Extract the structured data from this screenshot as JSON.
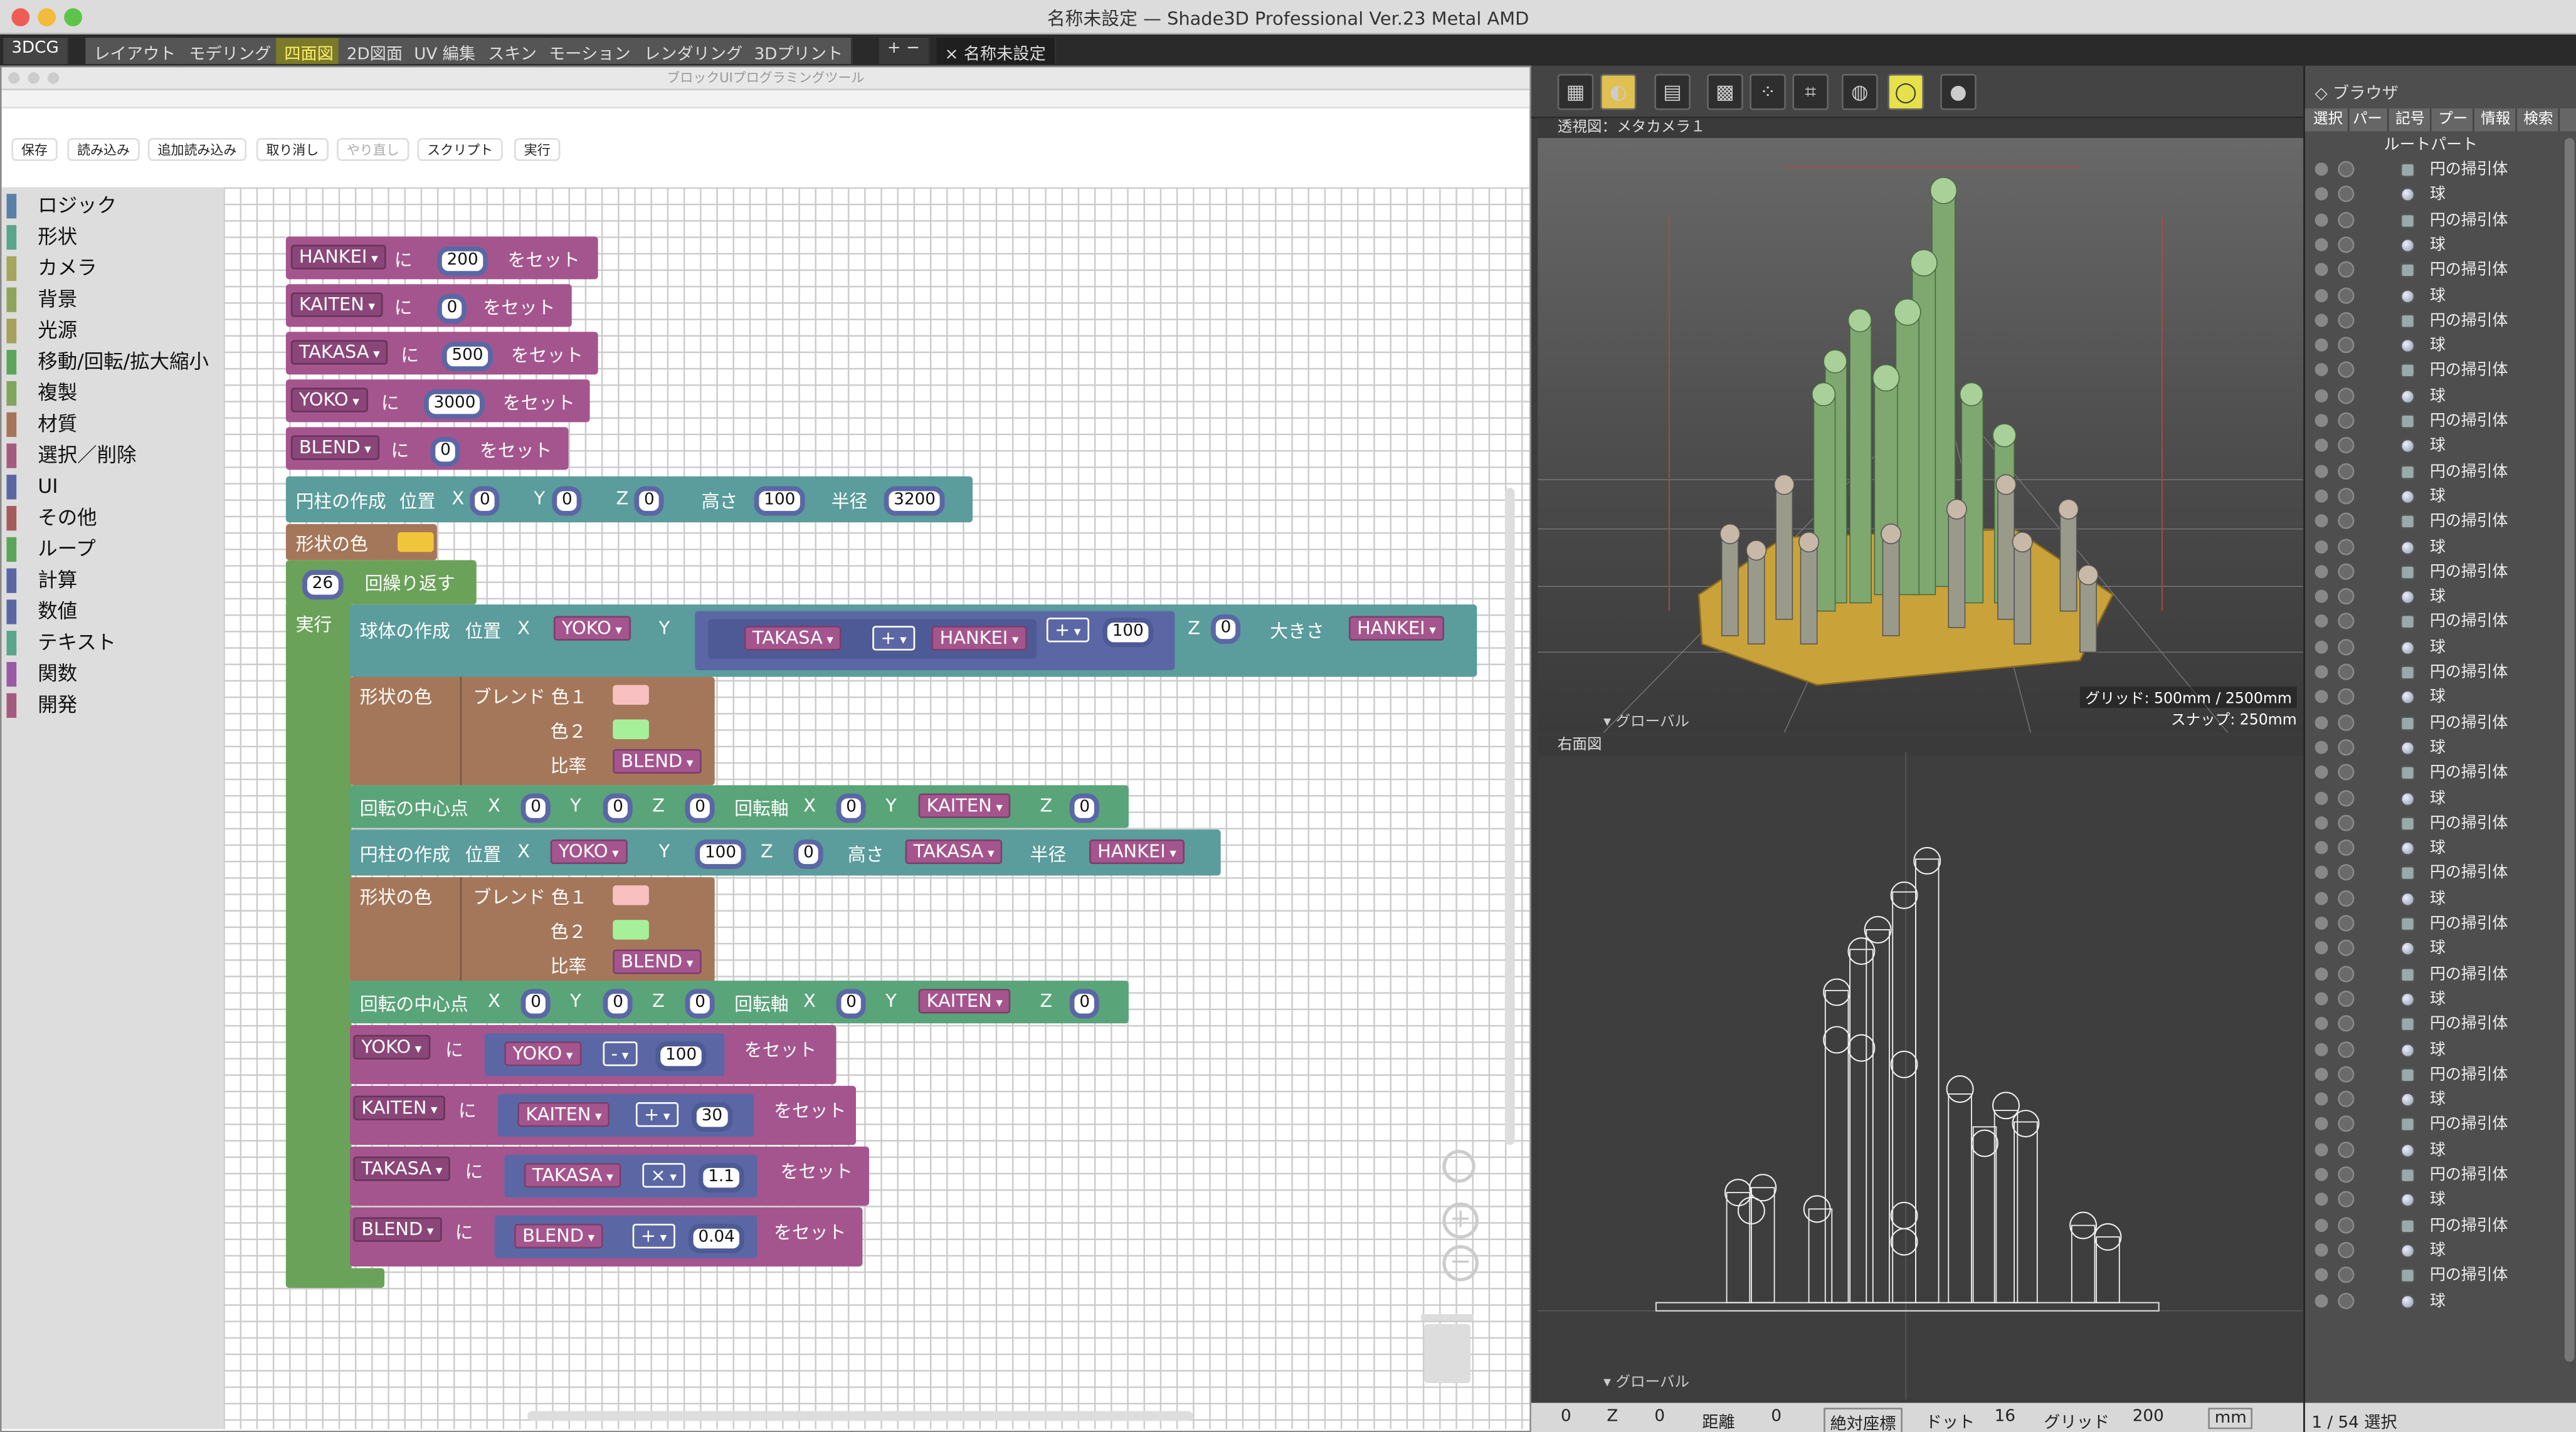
{
  "window": {
    "title": "名称未設定 — Shade3D Professional Ver.23 Metal AMD"
  },
  "tabs": [
    "3DCG",
    "レイアウト",
    "モデリング",
    "四面図",
    "2D図面",
    "UV 編集",
    "スキン",
    "モーション",
    "レンダリング",
    "3Dプリント",
    "+ −",
    "× 名称未設定"
  ],
  "editor": {
    "title": "ブロックUIプログラミングツール",
    "toolbar": [
      "保存",
      "読み込み",
      "追加読み込み",
      "取り消し",
      "やり直し",
      "スクリプト",
      "実行"
    ],
    "categories": [
      {
        "label": "ロジック",
        "color": "#5b80a5"
      },
      {
        "label": "形状",
        "color": "#5ba58c"
      },
      {
        "label": "カメラ",
        "color": "#a5a55b"
      },
      {
        "label": "背景",
        "color": "#8ca55b"
      },
      {
        "label": "光源",
        "color": "#a5a05b"
      },
      {
        "label": "移動/回転/拡大縮小",
        "color": "#5ba55b"
      },
      {
        "label": "複製",
        "color": "#80a55b"
      },
      {
        "label": "材質",
        "color": "#a5745b"
      },
      {
        "label": "選択／削除",
        "color": "#a55b80"
      },
      {
        "label": "UI",
        "color": "#5b67a5"
      },
      {
        "label": "その他",
        "color": "#a55b5b"
      },
      {
        "label": "ループ",
        "color": "#5ba55b"
      },
      {
        "label": "計算",
        "color": "#5b67a5"
      },
      {
        "label": "数値",
        "color": "#5b67a5"
      },
      {
        "label": "テキスト",
        "color": "#5ba58c"
      },
      {
        "label": "関数",
        "color": "#995ba5"
      },
      {
        "label": "開発",
        "color": "#a55b80"
      }
    ],
    "blocks": {
      "ni": "に",
      "set": "をセット",
      "x": "X",
      "y": "Y",
      "z": "Z",
      "v_hankei": "HANKEI",
      "v_kaiten": "KAITEN",
      "v_takasa": "TAKASA",
      "v_yoko": "YOKO",
      "v_blend": "BLEND",
      "n200": "200",
      "n0": "0",
      "n500": "500",
      "n3000": "3000",
      "cyl_create": "円柱の作成",
      "pos": "位置",
      "height": "高さ",
      "radius": "半径",
      "n100": "100",
      "n3200": "3200",
      "shape_color": "形状の色",
      "repeat_n": "26",
      "repeat": "回繰り返す",
      "exec": "実行",
      "sphere_create": "球体の作成",
      "size": "大きさ",
      "op_plus": "+",
      "op_minus": "-",
      "op_times": "×",
      "blend_c1": "ブレンド 色１",
      "c2": "色２",
      "ratio": "比率",
      "rot_center": "回転の中心点",
      "rot_axis": "回転軸",
      "n30": "30",
      "n11": "1.1",
      "n004": "0.04"
    }
  },
  "viewport1": {
    "label": "透視図：メタカメラ１",
    "grid": "グリッド: 500mm / 2500mm",
    "snap": "スナップ: 250mm",
    "global": "▾ グローバル"
  },
  "viewport2": {
    "label": "右面図",
    "global": "▾ グローバル"
  },
  "statusbar": {
    "v1": "0",
    "z": "Z",
    "v2": "0",
    "dist": "距離",
    "v3": "0",
    "abs": "絶対座標",
    "dot": "ドット",
    "v4": "16",
    "grid": "グリッド",
    "v5": "200",
    "unit": "mm"
  },
  "browser": {
    "title": "◇ ブラウザ",
    "tabs": [
      "選択",
      "パー",
      "記号",
      "プー",
      "情報",
      "検索"
    ],
    "root": "ルートパート",
    "items": [
      "円の掃引体",
      "球",
      "円の掃引体",
      "球",
      "円の掃引体",
      "球",
      "円の掃引体",
      "球",
      "円の掃引体",
      "球",
      "円の掃引体",
      "球",
      "円の掃引体",
      "球",
      "円の掃引体",
      "球",
      "円の掃引体",
      "球",
      "円の掃引体",
      "球",
      "円の掃引体",
      "球",
      "円の掃引体",
      "球",
      "円の掃引体",
      "球",
      "円の掃引体",
      "球",
      "円の掃引体",
      "球",
      "円の掃引体",
      "球",
      "円の掃引体",
      "球",
      "円の掃引体",
      "球",
      "円の掃引体",
      "球",
      "円の掃引体",
      "球",
      "円の掃引体",
      "球",
      "円の掃引体",
      "球",
      "円の掃引体",
      "球"
    ],
    "status": "1 / 54 選択"
  },
  "colors": {
    "accent": "#ffee66",
    "variable": "#a5558e",
    "shape": "#5b9c9c",
    "material": "#a5775a",
    "loop": "#6ba25a",
    "math": "#5b67a5",
    "base_disc": "#c9a23a",
    "cylinder": "#7fa870"
  }
}
